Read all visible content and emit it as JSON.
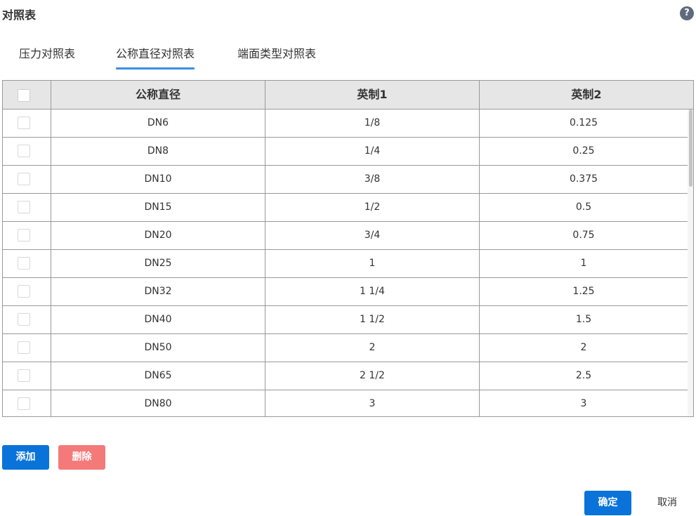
{
  "title": "对照表",
  "help_icon": "?",
  "tabs": [
    {
      "label": "压力对照表",
      "active": false
    },
    {
      "label": "公称直径对照表",
      "active": true
    },
    {
      "label": "端面类型对照表",
      "active": false
    }
  ],
  "table": {
    "columns": [
      "公称直径",
      "英制1",
      "英制2"
    ],
    "rows": [
      {
        "dn": "DN6",
        "inch1": "1/8",
        "inch2": "0.125"
      },
      {
        "dn": "DN8",
        "inch1": "1/4",
        "inch2": "0.25"
      },
      {
        "dn": "DN10",
        "inch1": "3/8",
        "inch2": "0.375"
      },
      {
        "dn": "DN15",
        "inch1": "1/2",
        "inch2": "0.5"
      },
      {
        "dn": "DN20",
        "inch1": "3/4",
        "inch2": "0.75"
      },
      {
        "dn": "DN25",
        "inch1": "1",
        "inch2": "1"
      },
      {
        "dn": "DN32",
        "inch1": "1 1/4",
        "inch2": "1.25"
      },
      {
        "dn": "DN40",
        "inch1": "1 1/2",
        "inch2": "1.5"
      },
      {
        "dn": "DN50",
        "inch1": "2",
        "inch2": "2"
      },
      {
        "dn": "DN65",
        "inch1": "2 1/2",
        "inch2": "2.5"
      },
      {
        "dn": "DN80",
        "inch1": "3",
        "inch2": "3"
      }
    ]
  },
  "buttons": {
    "add": "添加",
    "delete": "删除",
    "confirm": "确定",
    "cancel": "取消"
  },
  "colors": {
    "primary": "#0a73d9",
    "danger": "#f47a7a",
    "tab_underline": "#3a8ee6",
    "header_bg": "#e6e6e6"
  }
}
